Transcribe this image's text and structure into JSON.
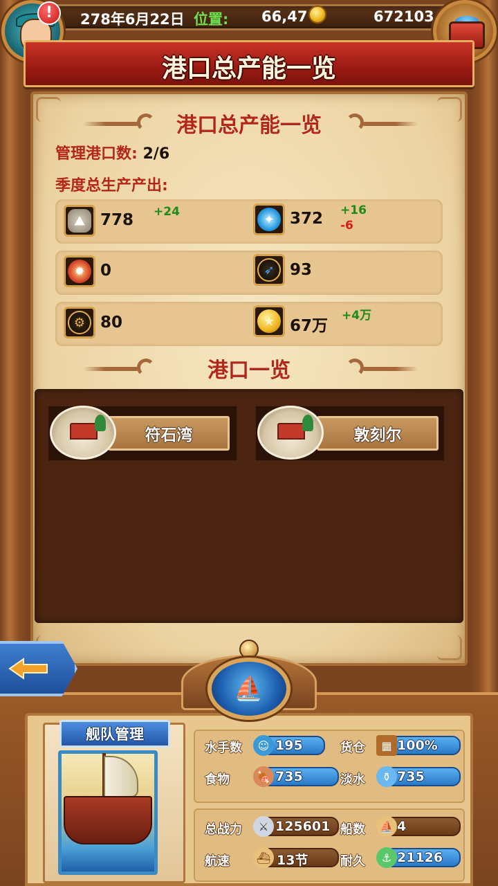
{
  "status_bar": {
    "date": "278年6月22日",
    "position_label": "位置:",
    "position_value": "66,47",
    "gold": "672103",
    "alert_badge": "!"
  },
  "header": {
    "title": "港口总产能一览"
  },
  "overview": {
    "section_title": "港口总产能一览",
    "managed_ports_label": "管理港口数:",
    "managed_ports_value": "2/6",
    "quarterly_output_label": "季度总生产产出:"
  },
  "resources": [
    {
      "icon": "stone-icon",
      "value": "778",
      "up": "+24",
      "down": ""
    },
    {
      "icon": "crystal-icon",
      "value": "372",
      "up": "+16",
      "down": "-6"
    },
    {
      "icon": "gear-badge-icon",
      "value": "0",
      "up": "",
      "down": ""
    },
    {
      "icon": "feather-badge-icon",
      "value": "93",
      "up": "",
      "down": ""
    },
    {
      "icon": "cog-icon",
      "value": "80",
      "up": "",
      "down": ""
    },
    {
      "icon": "gold-coin-icon",
      "value": "67万",
      "up": "+4万",
      "down": ""
    }
  ],
  "ports": {
    "section_title": "港口一览",
    "items": [
      {
        "name": "符石湾"
      },
      {
        "name": "敦刻尔"
      }
    ]
  },
  "fleet": {
    "title": "舰队管理",
    "stats": {
      "sailors_label": "水手数",
      "sailors_value": "195",
      "cargo_label": "货仓",
      "cargo_value": "100%",
      "food_label": "食物",
      "food_value": "735",
      "water_label": "淡水",
      "water_value": "735",
      "power_label": "总战力",
      "power_value": "125601",
      "ships_label": "船数",
      "ships_value": "4",
      "speed_label": "航速",
      "speed_value": "13节",
      "durability_label": "耐久",
      "durability_value": "21126"
    }
  },
  "colors": {
    "banner_red": "#b3261a",
    "positive": "#1e8a18",
    "negative": "#d81b10",
    "position_green": "#6ee04e",
    "stat_blue": "#2a78c8"
  }
}
